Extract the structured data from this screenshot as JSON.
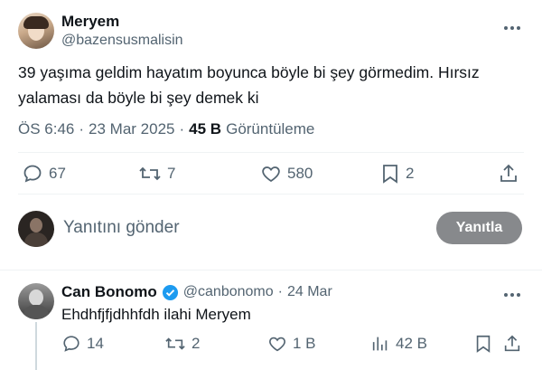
{
  "tweet": {
    "author": {
      "name": "Meryem",
      "handle": "@bazensusmalisin"
    },
    "text": "39 yaşıma geldim hayatım boyunca böyle bi şey görmedim. Hırsız yalaması da böyle bi şey demek ki",
    "time": "ÖS 6:46",
    "sep1": "·",
    "date": "23 Mar 2025",
    "sep2": "·",
    "views": "45 B",
    "views_label": "Görüntüleme",
    "actions": {
      "replies": "67",
      "retweets": "7",
      "likes": "580",
      "bookmarks": "2"
    },
    "icons": [
      "more-icon",
      "reply-icon",
      "retweet-icon",
      "like-icon",
      "bookmark-icon",
      "share-icon"
    ]
  },
  "composer": {
    "placeholder": "Yanıtını gönder",
    "button_label": "Yanıtla"
  },
  "reply": {
    "author": {
      "name": "Can Bonomo",
      "handle": "@canbonomo",
      "date": "24 Mar",
      "sep": "·"
    },
    "text": "Ehdhfjfjdhhfdh ilahi Meryem",
    "actions": {
      "replies": "14",
      "retweets": "2",
      "likes": "1 B",
      "views": "42 B"
    }
  },
  "colors": {
    "verified": "#1d9bf0",
    "button_bg": "#87898c",
    "divider": "#eff3f4",
    "text": "#0f1419",
    "muted": "#536471"
  }
}
